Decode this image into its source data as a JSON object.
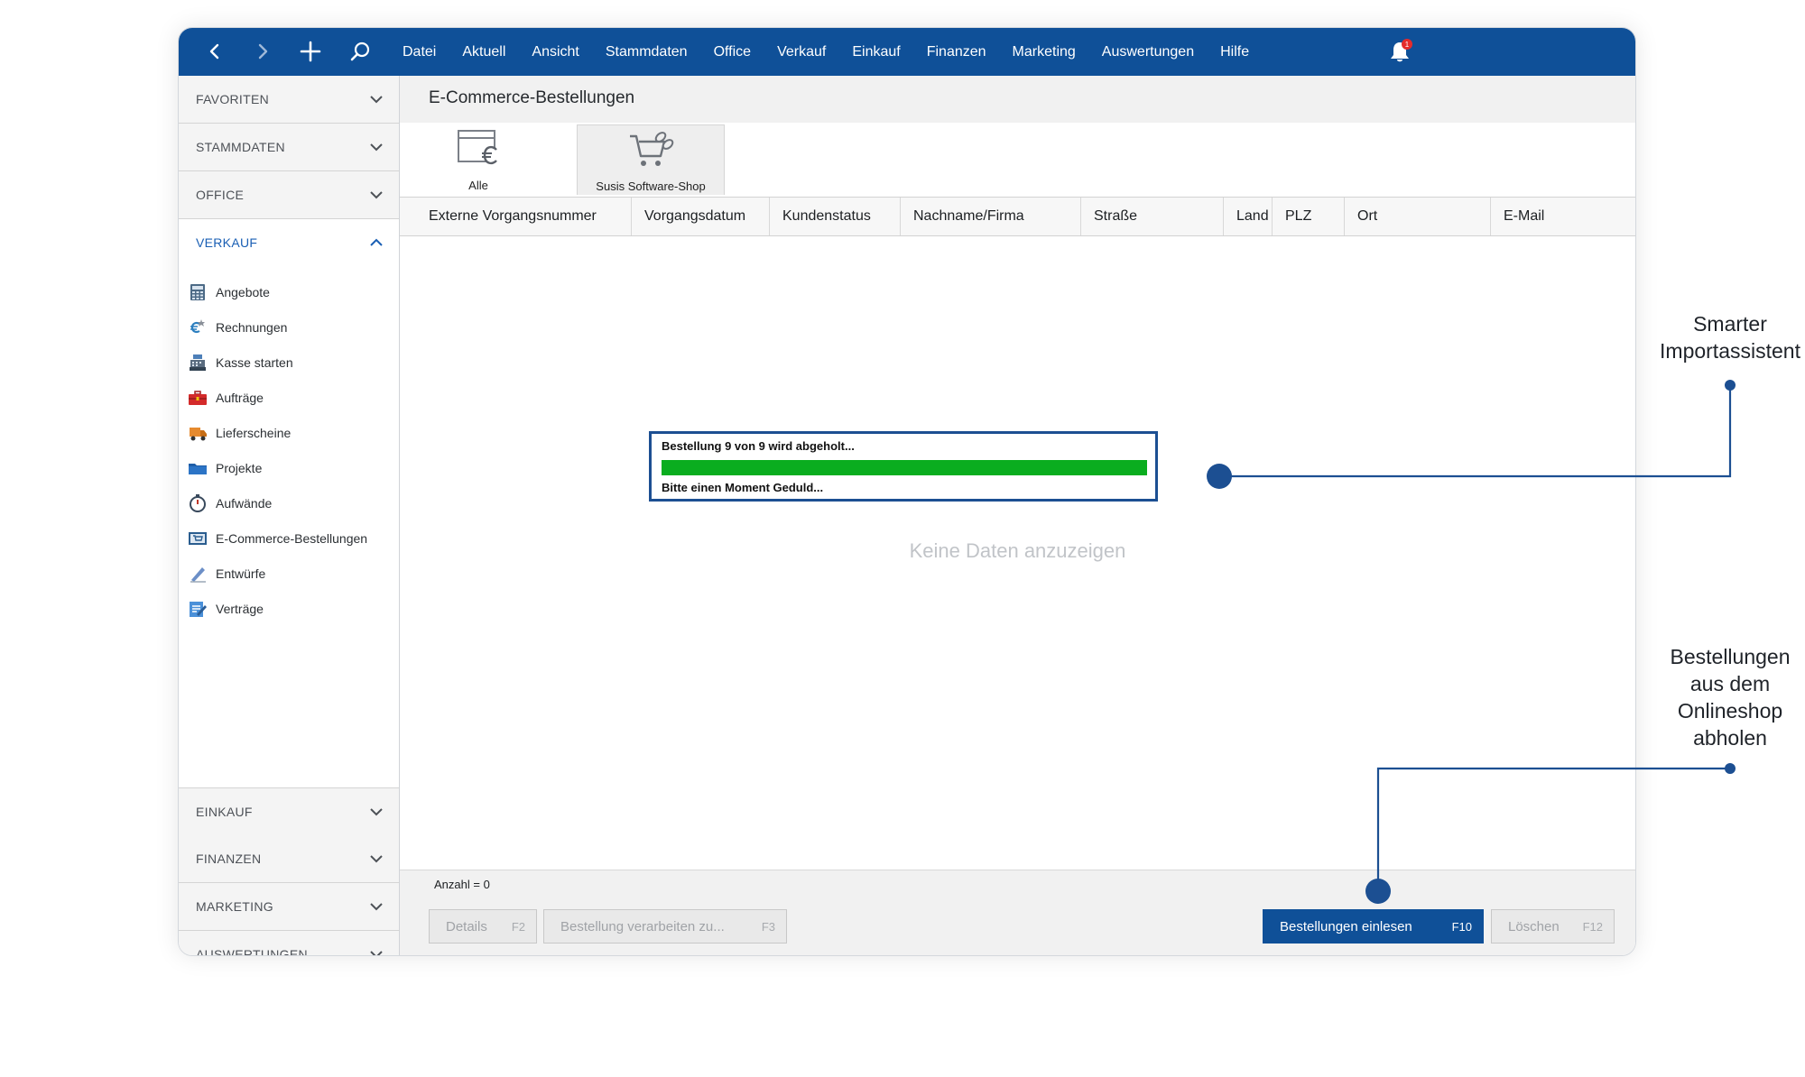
{
  "colors": {
    "brand": "#0f5098",
    "progress": "#0aad1f",
    "connector": "#1c4f92",
    "badge": "#e52b2b"
  },
  "menubar": [
    "Datei",
    "Aktuell",
    "Ansicht",
    "Stammdaten",
    "Office",
    "Verkauf",
    "Einkauf",
    "Finanzen",
    "Marketing",
    "Auswertungen",
    "Hilfe"
  ],
  "nav_icons": [
    "back-icon",
    "forward-icon",
    "plus-icon",
    "search-icon",
    "bell-icon"
  ],
  "notification_badge": "1",
  "sidebar": {
    "sections_top": [
      "FAVORITEN",
      "STAMMDATEN",
      "OFFICE"
    ],
    "active_section": "VERKAUF",
    "items": [
      "Angebote",
      "Rechnungen",
      "Kasse starten",
      "Aufträge",
      "Lieferscheine",
      "Projekte",
      "Aufwände",
      "E-Commerce-Bestellungen",
      "Entwürfe",
      "Verträge"
    ],
    "sections_bottom": [
      "EINKAUF",
      "FINANZEN",
      "MARKETING",
      "AUSWERTUNGEN"
    ]
  },
  "page_title": "E-Commerce-Bestellungen",
  "tabs": [
    {
      "label": "Alle",
      "icon": "euro-window-icon",
      "selected": false
    },
    {
      "label": "Susis Software-Shop",
      "icon": "shop-cart-icon",
      "selected": true
    }
  ],
  "columns": [
    "Externe Vorgangsnummer",
    "Vorgangsdatum",
    "Kundenstatus",
    "Nachname/Firma",
    "Straße",
    "Land",
    "PLZ",
    "Ort",
    "E-Mail"
  ],
  "empty_text": "Keine Daten anzuzeigen",
  "progress": {
    "title": "Bestellung 9 von 9 wird abgeholt...",
    "subtitle": "Bitte einen Moment Geduld...",
    "fraction": 1.0
  },
  "status": "Anzahl = 0",
  "buttons": {
    "details": {
      "label": "Details",
      "key": "F2"
    },
    "process": {
      "label": "Bestellung verarbeiten zu...",
      "key": "F3"
    },
    "import": {
      "label": "Bestellungen einlesen",
      "key": "F10"
    },
    "delete": {
      "label": "Löschen",
      "key": "F12"
    }
  },
  "annotations": {
    "import_assistant": [
      "Smarter",
      "Importassistent"
    ],
    "fetch_orders": [
      "Bestellungen",
      "aus dem",
      "Onlineshop",
      "abholen"
    ]
  }
}
